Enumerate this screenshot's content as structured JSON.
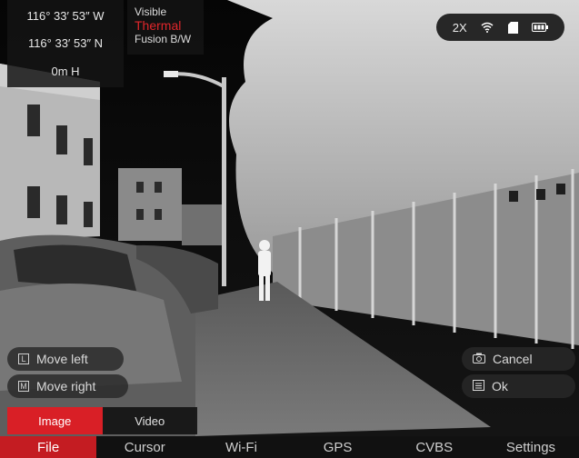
{
  "coords": {
    "longitude": "116° 33′ 53″ W",
    "latitude": "116° 33′ 53″ N",
    "height": "0m H"
  },
  "modes": {
    "items": [
      "Visible",
      "Thermal",
      "Fusion B/W"
    ],
    "selected": "Thermal"
  },
  "status": {
    "zoom": "2X",
    "icons": [
      "wifi-icon",
      "sd-card-icon",
      "battery-icon"
    ]
  },
  "controls": {
    "move_left": "Move left",
    "move_right": "Move right",
    "cancel": "Cancel",
    "ok": "Ok",
    "move_left_key": "L",
    "move_right_key": "M"
  },
  "subtabs": {
    "image": "Image",
    "video": "Video",
    "active": "Image"
  },
  "tabs": [
    "File",
    "Cursor",
    "Wi-Fi",
    "GPS",
    "CVBS",
    "Settings"
  ],
  "active_tab": "File",
  "colors": {
    "accent": "#d91f26",
    "tab_active": "#c41c22",
    "mode_active": "#e0262b"
  }
}
